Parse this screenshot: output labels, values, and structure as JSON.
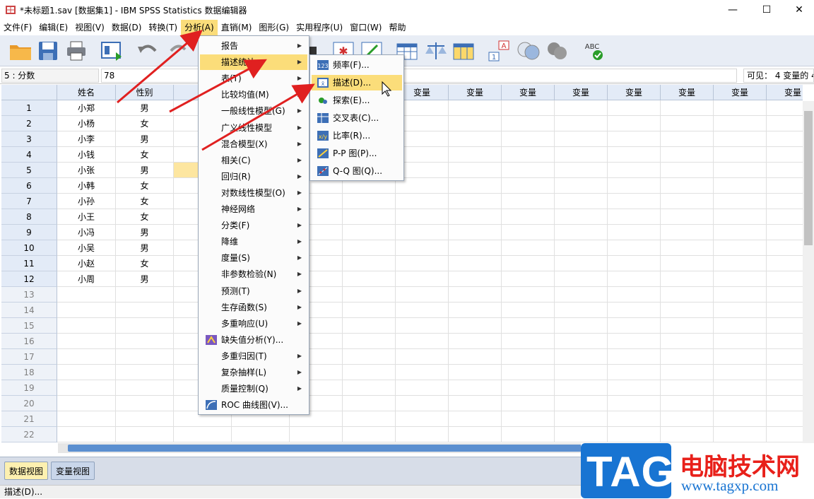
{
  "window": {
    "title": "*未标题1.sav [数据集1] - IBM SPSS Statistics 数据编辑器",
    "minimize": "—",
    "maximize": "☐",
    "close": "✕"
  },
  "menubar": [
    "文件(F)",
    "编辑(E)",
    "视图(V)",
    "数据(D)",
    "转换(T)",
    "分析(A)",
    "直销(M)",
    "图形(G)",
    "实用程序(U)",
    "窗口(W)",
    "帮助"
  ],
  "cellbar": {
    "cell_name": "5 : 分数",
    "cell_value": "78",
    "visible": "可见： 4 变量的 4"
  },
  "grid": {
    "col_headers": [
      "姓名",
      "性别",
      "分",
      "变量",
      "变量",
      "变量",
      "变量",
      "变量",
      "变量",
      "变量",
      "变量",
      "变量",
      "变量",
      "变量",
      "变量"
    ],
    "rows": [
      {
        "n": "1",
        "name": "小郑",
        "sex": "男"
      },
      {
        "n": "2",
        "name": "小杨",
        "sex": "女"
      },
      {
        "n": "3",
        "name": "小李",
        "sex": "男"
      },
      {
        "n": "4",
        "name": "小钱",
        "sex": "女"
      },
      {
        "n": "5",
        "name": "小张",
        "sex": "男"
      },
      {
        "n": "6",
        "name": "小韩",
        "sex": "女"
      },
      {
        "n": "7",
        "name": "小孙",
        "sex": "女"
      },
      {
        "n": "8",
        "name": "小王",
        "sex": "女"
      },
      {
        "n": "9",
        "name": "小冯",
        "sex": "男"
      },
      {
        "n": "10",
        "name": "小吴",
        "sex": "男"
      },
      {
        "n": "11",
        "name": "小赵",
        "sex": "女"
      },
      {
        "n": "12",
        "name": "小周",
        "sex": "男"
      }
    ],
    "empty_rows": [
      "13",
      "14",
      "15",
      "16",
      "17",
      "18",
      "19",
      "20",
      "21",
      "22"
    ]
  },
  "analyze_menu": [
    "报告",
    "描述统计",
    "表(T)",
    "比较均值(M)",
    "一般线性模型(G)",
    "广义线性模型",
    "混合模型(X)",
    "相关(C)",
    "回归(R)",
    "对数线性模型(O)",
    "神经网络",
    "分类(F)",
    "降维",
    "度量(S)",
    "非参数检验(N)",
    "预测(T)",
    "生存函数(S)",
    "多重响应(U)",
    "缺失值分析(Y)...",
    "多重归因(T)",
    "复杂抽样(L)",
    "质量控制(Q)",
    "ROC 曲线图(V)..."
  ],
  "descriptive_menu": [
    "频率(F)...",
    "描述(D)...",
    "探索(E)...",
    "交叉表(C)...",
    "比率(R)...",
    "P-P 图(P)...",
    "Q-Q 图(Q)..."
  ],
  "tabs": {
    "data_view": "数据视图",
    "variable_view": "变量视图"
  },
  "status": "描述(D)...",
  "watermark": {
    "tag": "TAG",
    "cn": "电脑技术网",
    "url": "www.tagxp.com"
  },
  "colors": {
    "accent": "#fbdd7a",
    "arrow": "#e02020",
    "watermark_blue": "#1874d2",
    "watermark_red": "#e8201a"
  }
}
